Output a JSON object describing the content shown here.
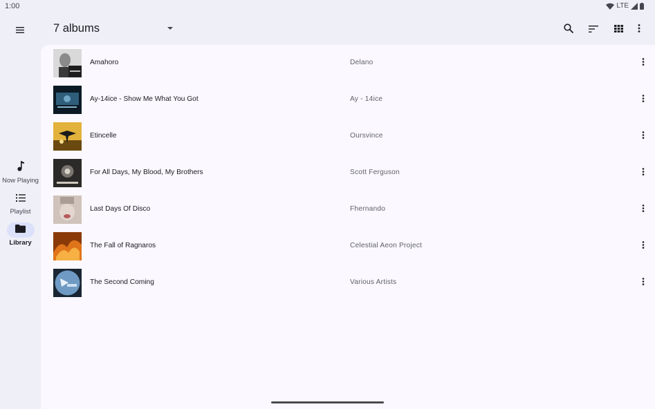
{
  "status": {
    "time": "1:00",
    "network": "LTE"
  },
  "header": {
    "title": "7 albums"
  },
  "rail": {
    "items": [
      {
        "label": "Now Playing",
        "icon": "music-note-icon"
      },
      {
        "label": "Playlist",
        "icon": "playlist-icon"
      },
      {
        "label": "Library",
        "icon": "folder-icon",
        "active": true
      }
    ]
  },
  "albums": [
    {
      "title": "Amahoro",
      "artist": "Delano"
    },
    {
      "title": "Ay-14ice - Show Me What You Got",
      "artist": "Ay - 14ice"
    },
    {
      "title": "Etincelle",
      "artist": "Oursvince"
    },
    {
      "title": "For All Days, My Blood, My Brothers",
      "artist": "Scott Ferguson"
    },
    {
      "title": "Last Days Of Disco",
      "artist": "Fhernando"
    },
    {
      "title": "The Fall of Ragnaros",
      "artist": "Celestial Aeon Project"
    },
    {
      "title": "The Second Coming",
      "artist": "Various Artists"
    }
  ],
  "colors": {
    "accent": "#dbe1fb",
    "background": "#efeff7",
    "surface": "#fbf8ff"
  }
}
